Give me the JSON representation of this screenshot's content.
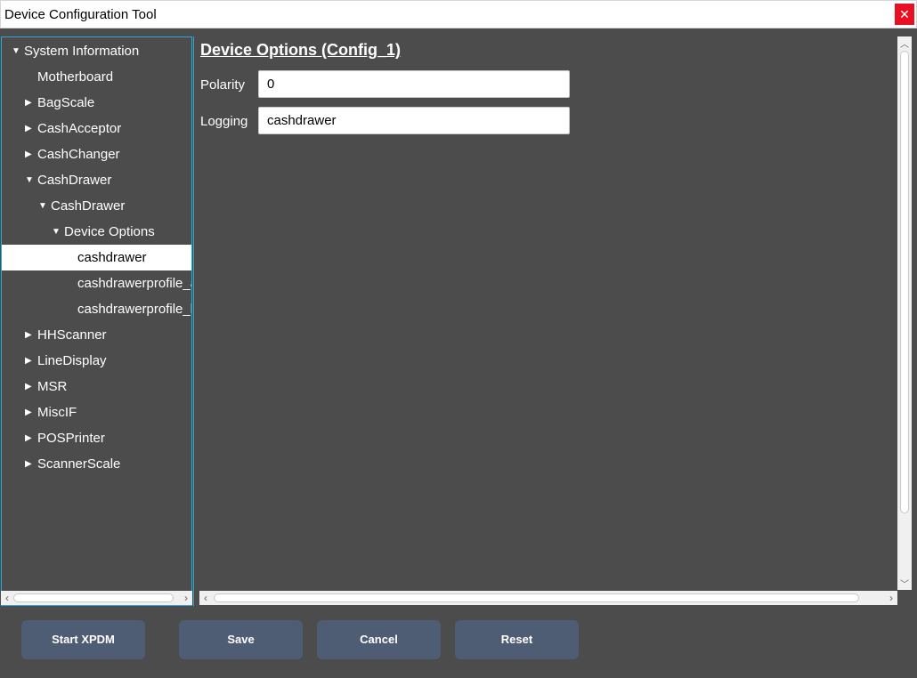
{
  "window": {
    "title": "Device Configuration Tool",
    "close_glyph": "✕"
  },
  "tree": [
    {
      "label": "System Information",
      "arrow": "▼",
      "level": 0
    },
    {
      "label": "Motherboard",
      "arrow": "",
      "level": 1
    },
    {
      "label": "BagScale",
      "arrow": "▶",
      "level": 1
    },
    {
      "label": "CashAcceptor",
      "arrow": "▶",
      "level": 1
    },
    {
      "label": "CashChanger",
      "arrow": "▶",
      "level": 1
    },
    {
      "label": "CashDrawer",
      "arrow": "▼",
      "level": 1
    },
    {
      "label": "CashDrawer",
      "arrow": "▼",
      "level": 2
    },
    {
      "label": "Device Options",
      "arrow": "▼",
      "level": 3
    },
    {
      "label": "cashdrawer",
      "arrow": "",
      "level": 4,
      "selected": true
    },
    {
      "label": "cashdrawerprofile_a",
      "arrow": "",
      "level": 4
    },
    {
      "label": "cashdrawerprofile_b",
      "arrow": "",
      "level": 4
    },
    {
      "label": "HHScanner",
      "arrow": "▶",
      "level": 1
    },
    {
      "label": "LineDisplay",
      "arrow": "▶",
      "level": 1
    },
    {
      "label": "MSR",
      "arrow": "▶",
      "level": 1
    },
    {
      "label": "MiscIF",
      "arrow": "▶",
      "level": 1
    },
    {
      "label": "POSPrinter",
      "arrow": "▶",
      "level": 1
    },
    {
      "label": "ScannerScale",
      "arrow": "▶",
      "level": 1
    }
  ],
  "content": {
    "heading": "Device Options (Config_1)",
    "fields": [
      {
        "label": "Polarity",
        "value": "0"
      },
      {
        "label": "Logging",
        "value": "cashdrawer"
      }
    ]
  },
  "scroll_glyphs": {
    "left": "‹",
    "right": "›",
    "up": "︿",
    "down": "﹀"
  },
  "buttons": {
    "start_xpdm": "Start XPDM",
    "save": "Save",
    "cancel": "Cancel",
    "reset": "Reset"
  },
  "colors": {
    "accent": "#2aa8d8",
    "button": "#4f5d74",
    "background": "#4c4c4c",
    "close": "#e81123"
  }
}
